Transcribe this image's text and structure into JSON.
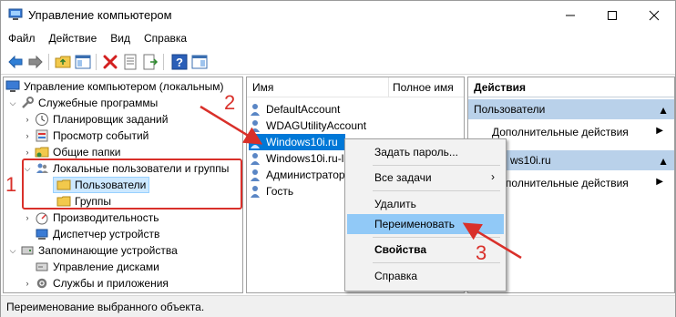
{
  "window": {
    "title": "Управление компьютером"
  },
  "menu": [
    "Файл",
    "Действие",
    "Вид",
    "Справка"
  ],
  "tree": {
    "root": "Управление компьютером (локальным)",
    "utilities": "Служебные программы",
    "scheduler": "Планировщик заданий",
    "events": "Просмотр событий",
    "shared": "Общие папки",
    "local_users": "Локальные пользователи и группы",
    "users": "Пользователи",
    "groups": "Группы",
    "performance": "Производительность",
    "devmgr": "Диспетчер устройств",
    "storage": "Запоминающие устройства",
    "disk": "Управление дисками",
    "services": "Службы и приложения"
  },
  "list": {
    "col_name": "Имя",
    "col_full": "Полное имя",
    "rows": [
      "DefaultAccount",
      "WDAGUtilityAccount",
      "Windows10i.ru",
      "Windows10i.ru-l",
      "Администратор",
      "Гость"
    ]
  },
  "actions": {
    "header": "Действия",
    "section1": "Пользователи",
    "more1": "Дополнительные действия",
    "section2": "ws10i.ru",
    "more2": "Дополнительные действия"
  },
  "context_menu": {
    "set_password": "Задать пароль...",
    "all_tasks": "Все задачи",
    "delete": "Удалить",
    "rename": "Переименовать",
    "properties": "Свойства",
    "help": "Справка"
  },
  "status": "Переименование выбранного объекта.",
  "annotations": {
    "n1": "1",
    "n2": "2",
    "n3": "3"
  },
  "colors": {
    "annotation_red": "#d9302a",
    "selection_blue": "#0078d7",
    "action_section": "#b9d1ea",
    "menu_highlight": "#91c9f7"
  }
}
